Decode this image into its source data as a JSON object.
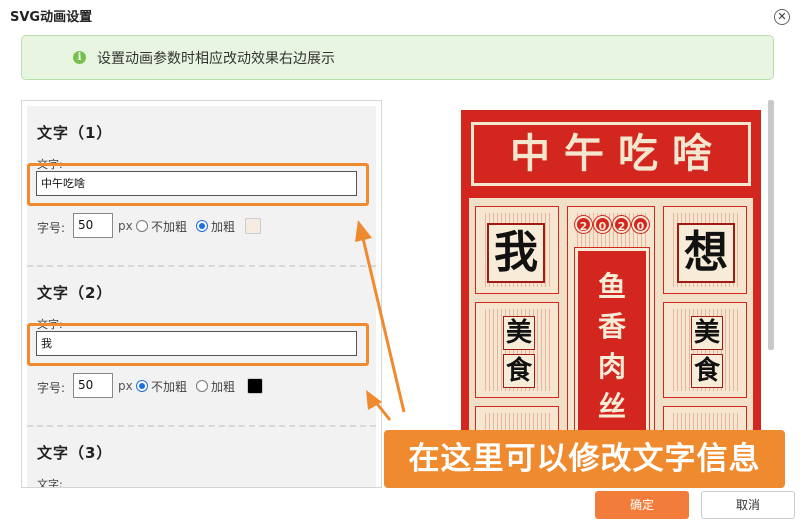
{
  "dialog": {
    "title": "SVG动画设置",
    "close_icon": "close-icon",
    "notice": "设置动画参数时相应改动效果右边展示",
    "notice_icon": "info-icon"
  },
  "sections": [
    {
      "title": "文字（1）",
      "text_label": "文字:",
      "text_value": "中午吃啥",
      "size_label": "字号:",
      "size_value": "50",
      "size_unit": "px",
      "option_normal": "不加粗",
      "option_bold": "加粗",
      "selected": "bold",
      "color": "#f6ede2"
    },
    {
      "title": "文字（2）",
      "text_label": "文字:",
      "text_value": "我",
      "size_label": "字号:",
      "size_value": "50",
      "size_unit": "px",
      "option_normal": "不加粗",
      "option_bold": "加粗",
      "selected": "normal",
      "color": "#000000"
    },
    {
      "title": "文字（3）",
      "text_label": "文字:"
    }
  ],
  "poster": {
    "title": "中午吃啥",
    "year": [
      "2",
      "0",
      "2",
      "0"
    ],
    "left_big": "我",
    "right_big": "想",
    "left_small": [
      "美",
      "食"
    ],
    "right_small": [
      "美",
      "食"
    ],
    "center": [
      "鱼",
      "香",
      "肉",
      "丝"
    ],
    "colors": {
      "red": "#d2261e",
      "cream": "#f3e6cf"
    }
  },
  "annotation": "在这里可以修改文字信息",
  "buttons": {
    "ok": "确定",
    "cancel": "取消"
  },
  "colors": {
    "accent_orange": "#f08a2e",
    "notice_bg": "#e8f6e1",
    "ok_button": "#f27c3a"
  }
}
